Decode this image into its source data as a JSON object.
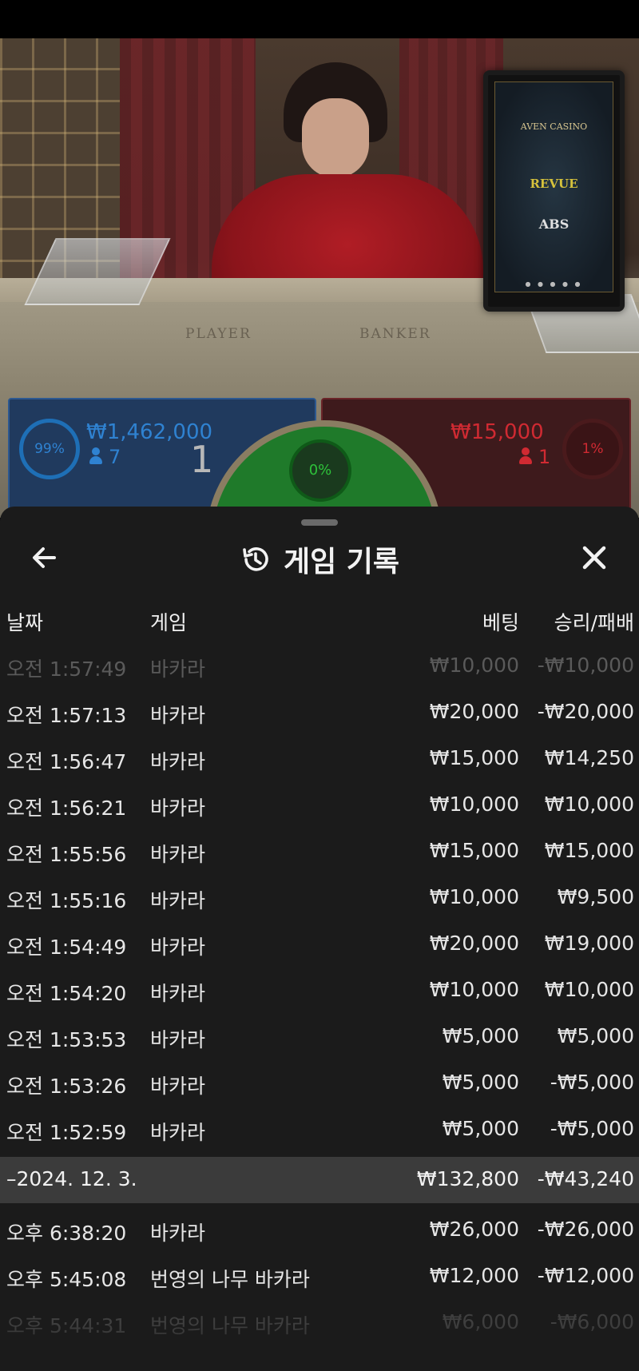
{
  "stream": {
    "monitor_brands": [
      "AVEN CASINO",
      "REVUE",
      "ABS"
    ],
    "table_labels": {
      "player": "PLAYER",
      "banker": "BANKER"
    }
  },
  "bets": {
    "player": {
      "percent": "99%",
      "amount": "₩1,462,000",
      "players": "7",
      "count": "1",
      "color": "#2f82d1"
    },
    "tie": {
      "percent": "0%",
      "color": "#2ec13a"
    },
    "banker": {
      "percent": "1%",
      "amount": "₩15,000",
      "players": "1",
      "color": "#d02a32"
    }
  },
  "history": {
    "title": "게임 기록",
    "back_icon": "arrow-left-icon",
    "close_icon": "close-icon",
    "title_icon": "history-icon",
    "columns": {
      "date": "날짜",
      "game": "게임",
      "bet": "베팅",
      "result": "승리/패배"
    },
    "rows": [
      {
        "time": "오전 1:57:49",
        "game": "바카라",
        "bet": "₩10,000",
        "result": "-₩10,000"
      },
      {
        "time": "오전 1:57:13",
        "game": "바카라",
        "bet": "₩20,000",
        "result": "-₩20,000"
      },
      {
        "time": "오전 1:56:47",
        "game": "바카라",
        "bet": "₩15,000",
        "result": "₩14,250"
      },
      {
        "time": "오전 1:56:21",
        "game": "바카라",
        "bet": "₩10,000",
        "result": "₩10,000"
      },
      {
        "time": "오전 1:55:56",
        "game": "바카라",
        "bet": "₩15,000",
        "result": "₩15,000"
      },
      {
        "time": "오전 1:55:16",
        "game": "바카라",
        "bet": "₩10,000",
        "result": "₩9,500"
      },
      {
        "time": "오전 1:54:49",
        "game": "바카라",
        "bet": "₩20,000",
        "result": "₩19,000"
      },
      {
        "time": "오전 1:54:20",
        "game": "바카라",
        "bet": "₩10,000",
        "result": "₩10,000"
      },
      {
        "time": "오전 1:53:53",
        "game": "바카라",
        "bet": "₩5,000",
        "result": "₩5,000"
      },
      {
        "time": "오전 1:53:26",
        "game": "바카라",
        "bet": "₩5,000",
        "result": "-₩5,000"
      },
      {
        "time": "오전 1:52:59",
        "game": "바카라",
        "bet": "₩5,000",
        "result": "-₩5,000"
      }
    ],
    "day_summary": {
      "date": "–2024. 12. 3.",
      "bet_total": "₩132,800",
      "result_total": "-₩43,240"
    },
    "rows2": [
      {
        "time": "오후 6:38:20",
        "game": "바카라",
        "bet": "₩26,000",
        "result": "-₩26,000"
      },
      {
        "time": "오후 5:45:08",
        "game": "번영의 나무 바카라",
        "bet": "₩12,000",
        "result": "-₩12,000"
      },
      {
        "time": "오후 5:44:31",
        "game": "번영의 나무 바카라",
        "bet": "₩6,000",
        "result": "-₩6,000"
      }
    ]
  }
}
